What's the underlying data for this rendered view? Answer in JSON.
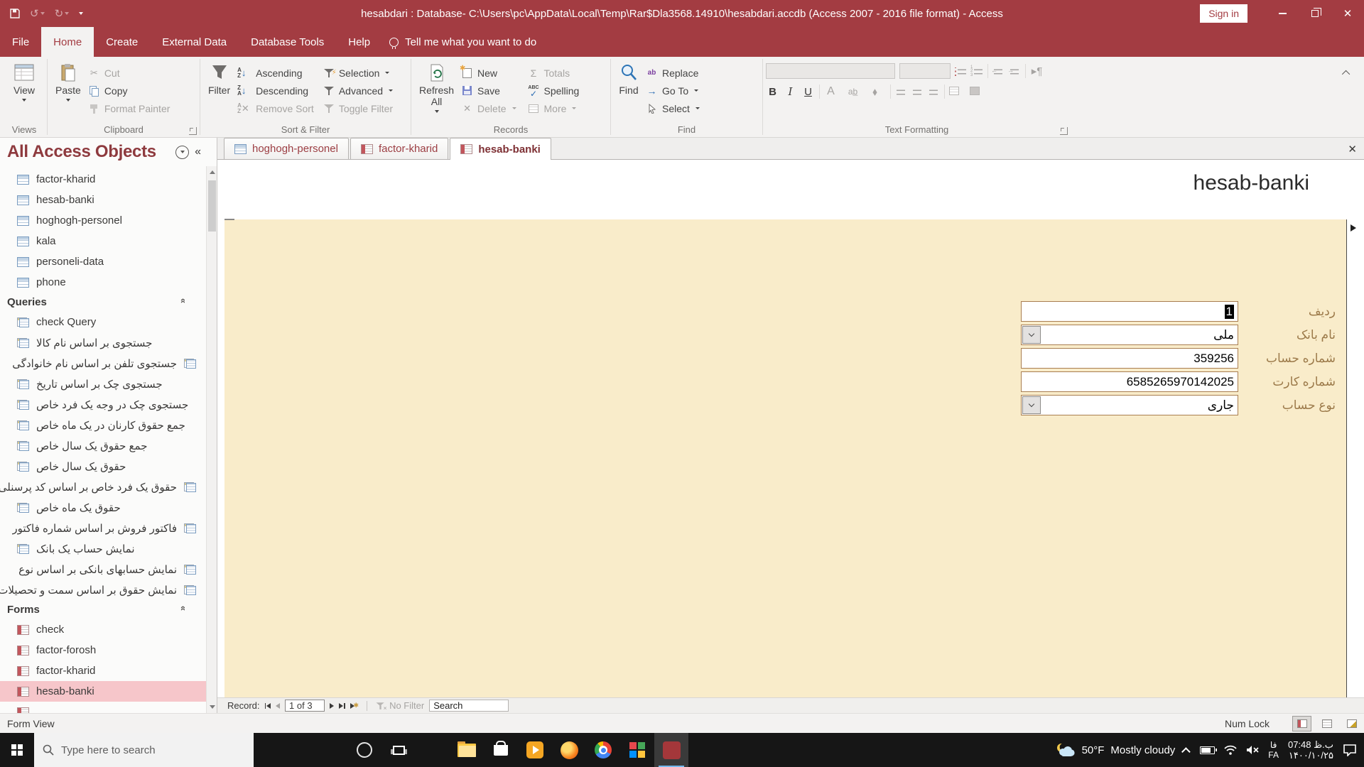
{
  "colors": {
    "titlebar": "#A33C42",
    "ribbon_bg": "#F3F2F1",
    "form_bg": "#F9ECCA",
    "selected_pink": "#F6C6CA",
    "field_border": "#A97E50",
    "label_brown": "#9C7A4A",
    "taskbar": "#161616",
    "access_red": "#A4373A"
  },
  "titlebar": {
    "title": "hesabdari : Database- C:\\Users\\pc\\AppData\\Local\\Temp\\Rar$Dla3568.14910\\hesabdari.accdb (Access 2007 - 2016 file format)  -  Access",
    "sign_in": "Sign in"
  },
  "ribbon": {
    "tabs": [
      {
        "label": "File"
      },
      {
        "label": "Home",
        "active": true
      },
      {
        "label": "Create"
      },
      {
        "label": "External Data"
      },
      {
        "label": "Database Tools"
      },
      {
        "label": "Help"
      }
    ],
    "tell_me": "Tell me what you want to do",
    "views": {
      "view": "View",
      "group": "Views"
    },
    "clipboard": {
      "paste": "Paste",
      "cut": "Cut",
      "copy": "Copy",
      "format_painter": "Format Painter",
      "group": "Clipboard"
    },
    "sortfilter": {
      "filter": "Filter",
      "ascending": "Ascending",
      "descending": "Descending",
      "remove_sort": "Remove Sort",
      "selection": "Selection",
      "advanced": "Advanced",
      "toggle_filter": "Toggle Filter",
      "group": "Sort & Filter"
    },
    "records": {
      "refresh1": "Refresh",
      "refresh2": "All",
      "new": "New",
      "save": "Save",
      "delete": "Delete",
      "totals": "Totals",
      "spelling": "Spelling",
      "more": "More",
      "group": "Records"
    },
    "find": {
      "find": "Find",
      "replace": "Replace",
      "goto": "Go To",
      "select": "Select",
      "group": "Find"
    },
    "textfmt": {
      "group": "Text Formatting"
    }
  },
  "nav": {
    "title": "All Access Objects",
    "tables": [
      {
        "label": "factor-kharid"
      },
      {
        "label": "hesab-banki"
      },
      {
        "label": "hoghogh-personel"
      },
      {
        "label": "kala"
      },
      {
        "label": "personeli-data"
      },
      {
        "label": "phone"
      }
    ],
    "queries_header": "Queries",
    "queries": [
      {
        "label": "check Query"
      },
      {
        "label": "جستجوی بر اساس نام کالا"
      },
      {
        "label": "جستجوی تلفن بر اساس نام خانوادگی",
        "side": "right"
      },
      {
        "label": "جستجوی چک بر اساس تاریخ"
      },
      {
        "label": "جستجوی چک در وجه یک فرد خاص"
      },
      {
        "label": "جمع حقوق کارنان در یک ماه خاص"
      },
      {
        "label": "جمع حقوق یک سال خاص"
      },
      {
        "label": "حقوق یک سال خاص"
      },
      {
        "label": "حقوق یک فرد خاص بر اساس کد پرسنلی",
        "side": "right"
      },
      {
        "label": "حقوق یک ماه خاص"
      },
      {
        "label": "فاکتور فروش بر اساس شماره فاکتور",
        "side": "right"
      },
      {
        "label": "نمایش حساب یک بانک"
      },
      {
        "label": "نمایش حسابهای بانکی بر اساس نوع",
        "side": "right"
      },
      {
        "label": "نمایش حقوق بر اساس سمت و تحصیلات",
        "side": "right"
      }
    ],
    "forms_header": "Forms",
    "forms": [
      {
        "label": "check"
      },
      {
        "label": "factor-forosh"
      },
      {
        "label": "factor-kharid"
      },
      {
        "label": "hesab-banki",
        "selected": true
      },
      {
        "label": "",
        "partial": true
      }
    ]
  },
  "docarea": {
    "tabs": [
      {
        "label": "hoghogh-personel",
        "type": "table"
      },
      {
        "label": "factor-kharid",
        "type": "form"
      },
      {
        "label": "hesab-banki",
        "type": "form",
        "active": true
      }
    ],
    "form_title": "hesab-banki",
    "fields": [
      {
        "label": "ردیف",
        "value": "1",
        "caret_selected": true
      },
      {
        "label": "نام بانک",
        "value": "ملی",
        "combo": true
      },
      {
        "label": "شماره حساب",
        "value": "359256"
      },
      {
        "label": "شماره کارت",
        "value": "6585265970142025"
      },
      {
        "label": "نوع حساب",
        "value": "جاری",
        "combo": true
      }
    ],
    "recordbar": {
      "record_label": "Record:",
      "position": "1 of 3",
      "no_filter": "No Filter",
      "search": "Search"
    }
  },
  "statusbar": {
    "left": "Form View",
    "num_lock": "Num Lock"
  },
  "taskbar": {
    "search_placeholder": "Type here to search",
    "icons": [
      {
        "name": "cortana"
      },
      {
        "name": "task-view"
      },
      {
        "name": "edge"
      },
      {
        "name": "file-explorer"
      },
      {
        "name": "store"
      },
      {
        "name": "media-player"
      },
      {
        "name": "firefox"
      },
      {
        "name": "chrome"
      },
      {
        "name": "photos"
      },
      {
        "name": "access",
        "active": true
      }
    ],
    "tray": {
      "temp": "50°F",
      "condition": "Mostly cloudy",
      "lang_native": "فا",
      "lang_latin": "FA",
      "time": "ب.ظ 07:48",
      "date": "۱۴۰۰/۱۰/۲۵"
    }
  }
}
